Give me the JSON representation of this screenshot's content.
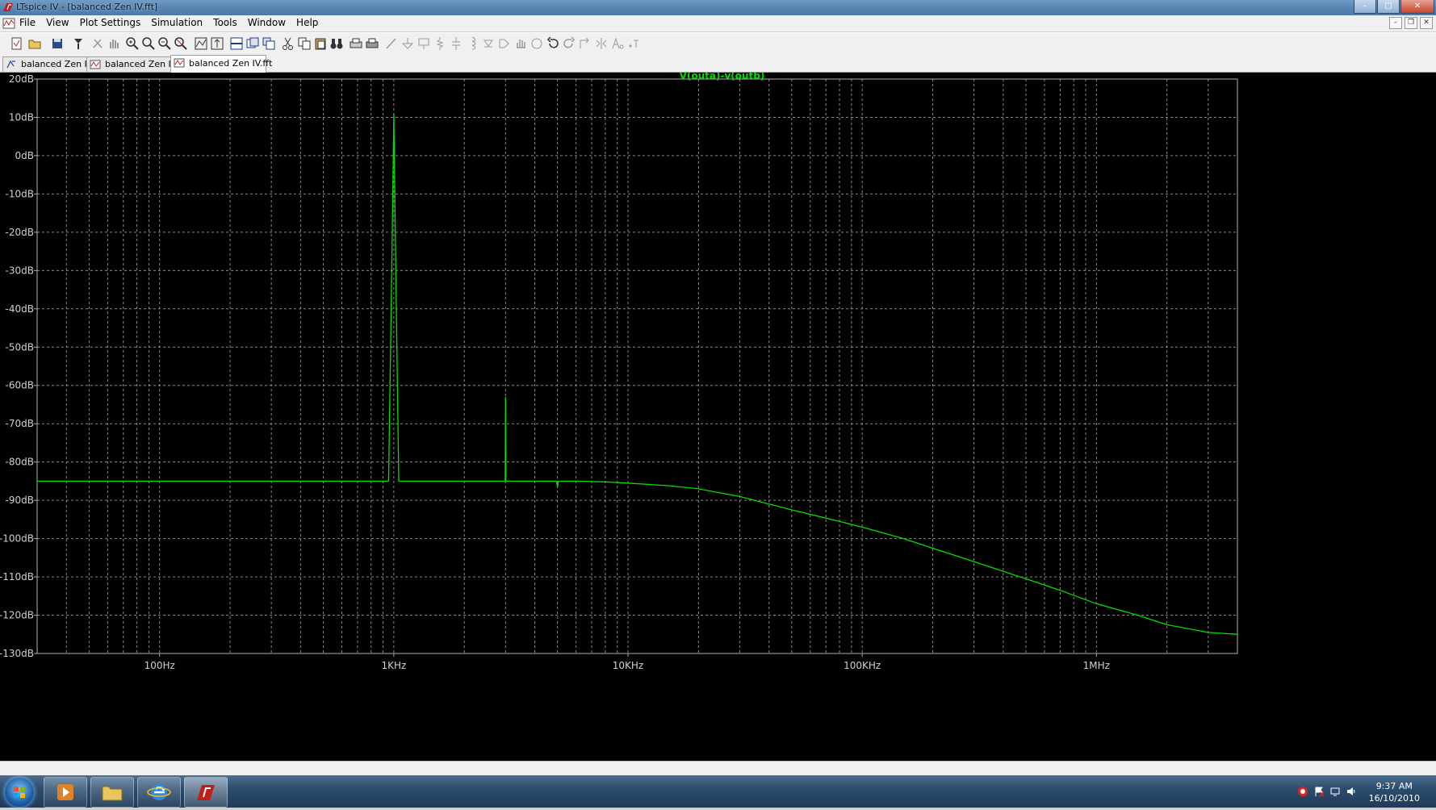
{
  "window": {
    "title": "LTspice IV - [balanced Zen IV.fft]"
  },
  "menu": [
    "File",
    "View",
    "Plot Settings",
    "Simulation",
    "Tools",
    "Window",
    "Help"
  ],
  "tabs": [
    {
      "label": "balanced Zen IV",
      "icon": "schematic-icon"
    },
    {
      "label": "balanced Zen IV",
      "icon": "waveform-icon"
    },
    {
      "label": "balanced Zen IV.fft",
      "icon": "waveform-icon",
      "active": true
    }
  ],
  "taskbar": {
    "time": "9:37 AM",
    "date": "16/10/2010"
  },
  "colors": {
    "trace": "#00e000",
    "grid": "#8a8a8a",
    "axis_text": "#d0d0d0",
    "background": "#000000"
  },
  "chart_data": {
    "type": "line",
    "title": "V(outa)-v(outb)",
    "x_scale": "log",
    "xlim": [
      30,
      4000000
    ],
    "ylim": [
      -130,
      20
    ],
    "grid": true,
    "x_ticks": [
      {
        "value": 100,
        "label": "100Hz"
      },
      {
        "value": 1000,
        "label": "1KHz"
      },
      {
        "value": 10000,
        "label": "10KHz"
      },
      {
        "value": 100000,
        "label": "100KHz"
      },
      {
        "value": 1000000,
        "label": "1MHz"
      }
    ],
    "y_ticks": [
      {
        "value": 20,
        "label": "20dB"
      },
      {
        "value": 10,
        "label": "10dB"
      },
      {
        "value": 0,
        "label": "0dB"
      },
      {
        "value": -10,
        "label": "-10dB"
      },
      {
        "value": -20,
        "label": "-20dB"
      },
      {
        "value": -30,
        "label": "-30dB"
      },
      {
        "value": -40,
        "label": "-40dB"
      },
      {
        "value": -50,
        "label": "-50dB"
      },
      {
        "value": -60,
        "label": "-60dB"
      },
      {
        "value": -70,
        "label": "-70dB"
      },
      {
        "value": -80,
        "label": "-80dB"
      },
      {
        "value": -90,
        "label": "-90dB"
      },
      {
        "value": -100,
        "label": "-100dB"
      },
      {
        "value": -110,
        "label": "-110dB"
      },
      {
        "value": -120,
        "label": "-120dB"
      },
      {
        "value": -130,
        "label": "-130dB"
      }
    ],
    "series": [
      {
        "name": "V(outa)-v(outb)",
        "x": [
          30,
          500,
          950,
          985,
          1000,
          1015,
          1050,
          2000,
          2990,
          3000,
          3010,
          3500,
          4950,
          5000,
          5050,
          6000,
          8000,
          10000,
          15000,
          20000,
          30000,
          50000,
          80000,
          100000,
          150000,
          200000,
          300000,
          500000,
          700000,
          1000000,
          1500000,
          2000000,
          3000000,
          4000000
        ],
        "y": [
          -85,
          -85,
          -85,
          -20,
          11,
          -20,
          -85,
          -85,
          -85,
          -63,
          -85,
          -85,
          -85,
          -86.5,
          -85,
          -85,
          -85.2,
          -85.5,
          -86.2,
          -87,
          -89,
          -92.5,
          -95.5,
          -97,
          -100,
          -102.5,
          -106,
          -110.5,
          -113.5,
          -117,
          -120,
          -122.5,
          -124.5,
          -125
        ]
      }
    ]
  }
}
